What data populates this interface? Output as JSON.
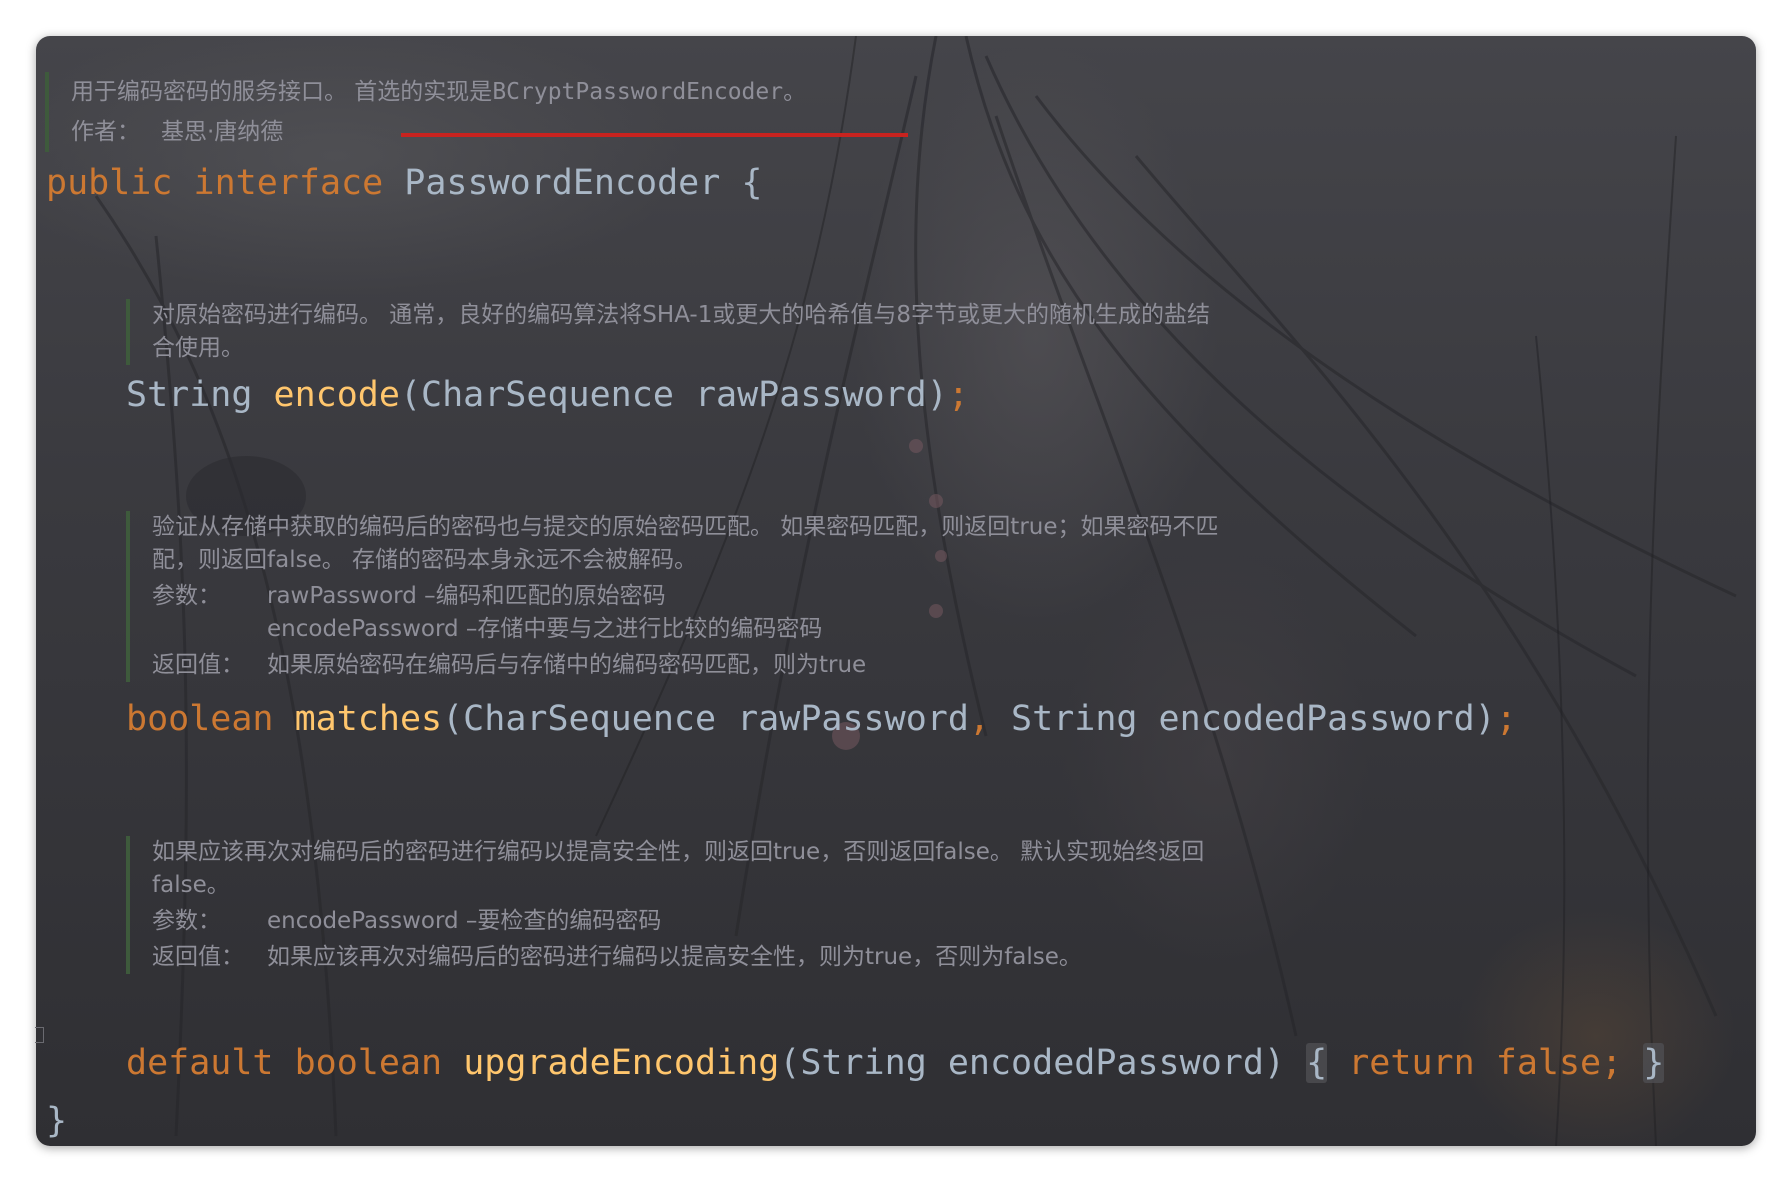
{
  "doc1": {
    "line1_cn": "用于编码密码的服务接口。 首选的实现是",
    "line1_code": "BCryptPasswordEncoder",
    "line1_end": " 。",
    "author_label": "作者：",
    "author_value": "基思·唐纳德"
  },
  "interface_decl": {
    "kw_public": "public",
    "kw_interface": "interface",
    "name": "PasswordEncoder",
    "brace_open": "{"
  },
  "doc2": {
    "line1": "对原始密码进行编码。 通常，良好的编码算法将SHA-1或更大的哈希值与8字节或更大的随机生成的盐结",
    "line2": "合使用。"
  },
  "method_encode": {
    "ret": "String",
    "name": "encode",
    "params": "(CharSequence rawPassword)",
    "semi": ";"
  },
  "doc3": {
    "line1": "验证从存储中获取的编码后的密码也与提交的原始密码匹配。 如果密码匹配，则返回true；如果密码不匹",
    "line2": "配，则返回false。 存储的密码本身永远不会被解码。",
    "params_label": "参数：",
    "param1": "rawPassword –编码和匹配的原始密码",
    "param2": "encodePassword –存储中要与之进行比较的编码密码",
    "returns_label": "返回值：",
    "returns": "如果原始密码在编码后与存储中的编码密码匹配，则为true"
  },
  "method_matches": {
    "ret": "boolean",
    "name": "matches",
    "p1": "(CharSequence rawPassword",
    "comma": ",",
    "p2": " String encodedPassword)",
    "semi": ";"
  },
  "doc4": {
    "line1": "如果应该再次对编码后的密码进行编码以提高安全性，则返回true，否则返回false。 默认实现始终返回",
    "line2": "false。",
    "params_label": "参数：",
    "param1": "encodePassword –要检查的编码密码",
    "returns_label": "返回值：",
    "returns": "如果应该再次对编码后的密码进行编码以提高安全性，则为true，否则为false。"
  },
  "method_upgrade": {
    "kw_default": "default",
    "ret": "boolean",
    "name": "upgradeEncoding",
    "params": "(String encodedPassword)",
    "brace_open": "{",
    "kw_return": "return",
    "kw_false": "false",
    "semi": ";",
    "brace_close": "}"
  },
  "interface_close": "}",
  "colors": {
    "keyword": "#cc7832",
    "method": "#ffc66d",
    "identifier": "#a9b7c6",
    "doc_text": "#8f8f99",
    "doc_bar": "#3e5a3c",
    "underline": "#c8231f",
    "editor_bg": "#3a3a3f"
  }
}
